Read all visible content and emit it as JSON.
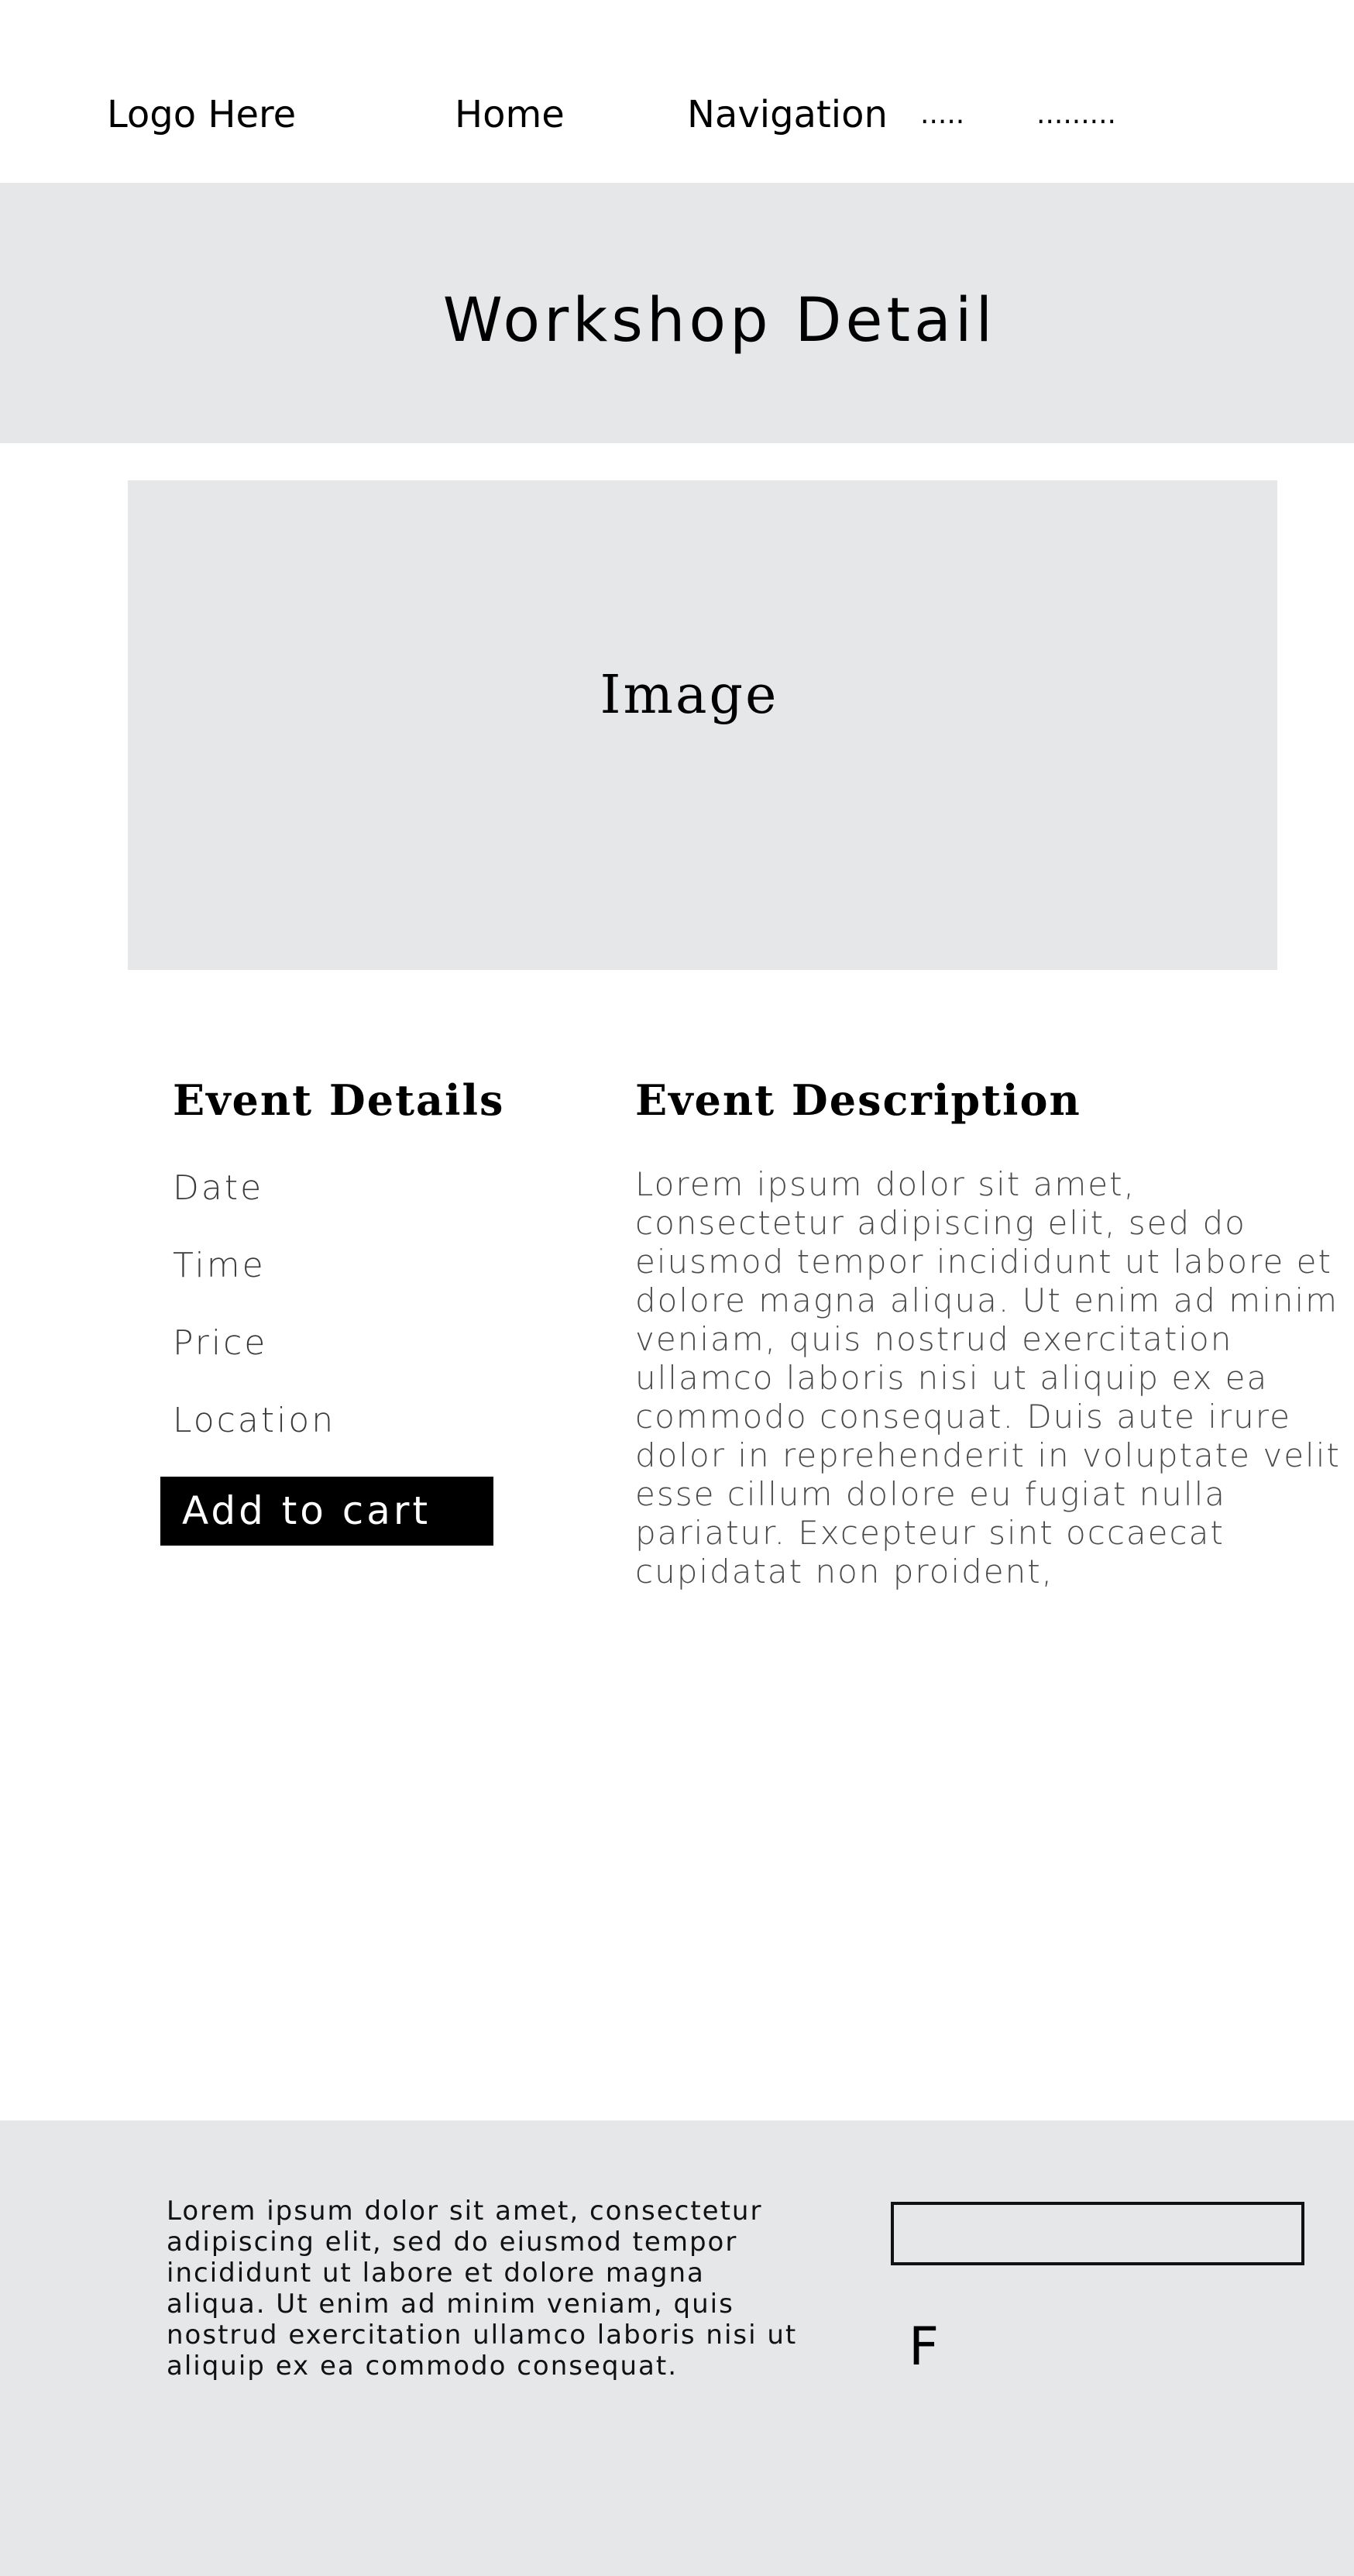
{
  "nav": {
    "logo": "Logo  Here",
    "home": "Home",
    "navigation": "Navigation",
    "dots_short": ".....",
    "dots_long": "........."
  },
  "banner": {
    "title": "Workshop Detail"
  },
  "image_placeholder": {
    "label": "Image"
  },
  "event_details": {
    "heading": "Event Details",
    "items": [
      "Date",
      "Time",
      "Price",
      "Location"
    ],
    "add_to_cart": "Add to cart"
  },
  "event_description": {
    "heading": "Event Description",
    "body": "Lorem ipsum dolor sit amet, consectetur adipiscing elit, sed do eiusmod tempor incididunt ut labore et dolore magna aliqua. Ut enim ad minim veniam, quis nostrud exercitation ullamco laboris nisi ut aliquip ex ea commodo consequat. Duis aute irure dolor in reprehenderit in voluptate velit esse cillum dolore eu fugiat nulla pariatur. Excepteur sint occaecat cupidatat non proident,"
  },
  "footer": {
    "text": "Lorem ipsum dolor sit amet, consectetur adipiscing elit, sed do eiusmod tempor incididunt ut labore et dolore magna aliqua. Ut enim ad minim veniam, quis nostrud exercitation ullamco laboris nisi ut aliquip ex ea commodo consequat.",
    "social_letter": "F"
  },
  "colors": {
    "panel_gray": "#e6e7e8",
    "button_black": "#000000",
    "page_white": "#ffffff"
  }
}
